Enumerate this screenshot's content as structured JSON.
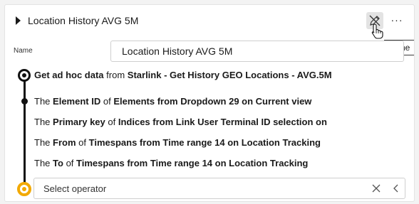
{
  "header": {
    "title": "Location History AVG 5M",
    "more_label": "···",
    "tooltip": "Done"
  },
  "name_field": {
    "label": "Name",
    "value": "Location History AVG 5M"
  },
  "source": {
    "prefix": "Get ad hoc data",
    "connector": "from",
    "dataset": "Starlink - Get History GEO Locations - AVG.5M"
  },
  "parameters": [
    {
      "lead": "The",
      "field": "Element ID",
      "of": "of",
      "source": "Elements from Dropdown 29 on Current view"
    },
    {
      "lead": "The",
      "field": "Primary key",
      "of": "of",
      "source": "Indices from Link User Terminal ID selection on"
    },
    {
      "lead": "The",
      "field": "From",
      "of": "of",
      "source": "Timespans from Time range 14 on Location Tracking"
    },
    {
      "lead": "The",
      "field": "To",
      "of": "of",
      "source": "Timespans from Time range 14 on Location Tracking"
    }
  ],
  "operator": {
    "placeholder": "Select operator"
  },
  "colors": {
    "accent_end_node": "#f2a900",
    "timeline": "#111111"
  },
  "icons": {
    "expand": "caret-right-icon",
    "done": "pencil-off-icon",
    "more": "more-horizontal-icon",
    "cursor": "hand-pointer-icon",
    "clear": "close-icon",
    "collapse": "chevron-left-icon"
  }
}
